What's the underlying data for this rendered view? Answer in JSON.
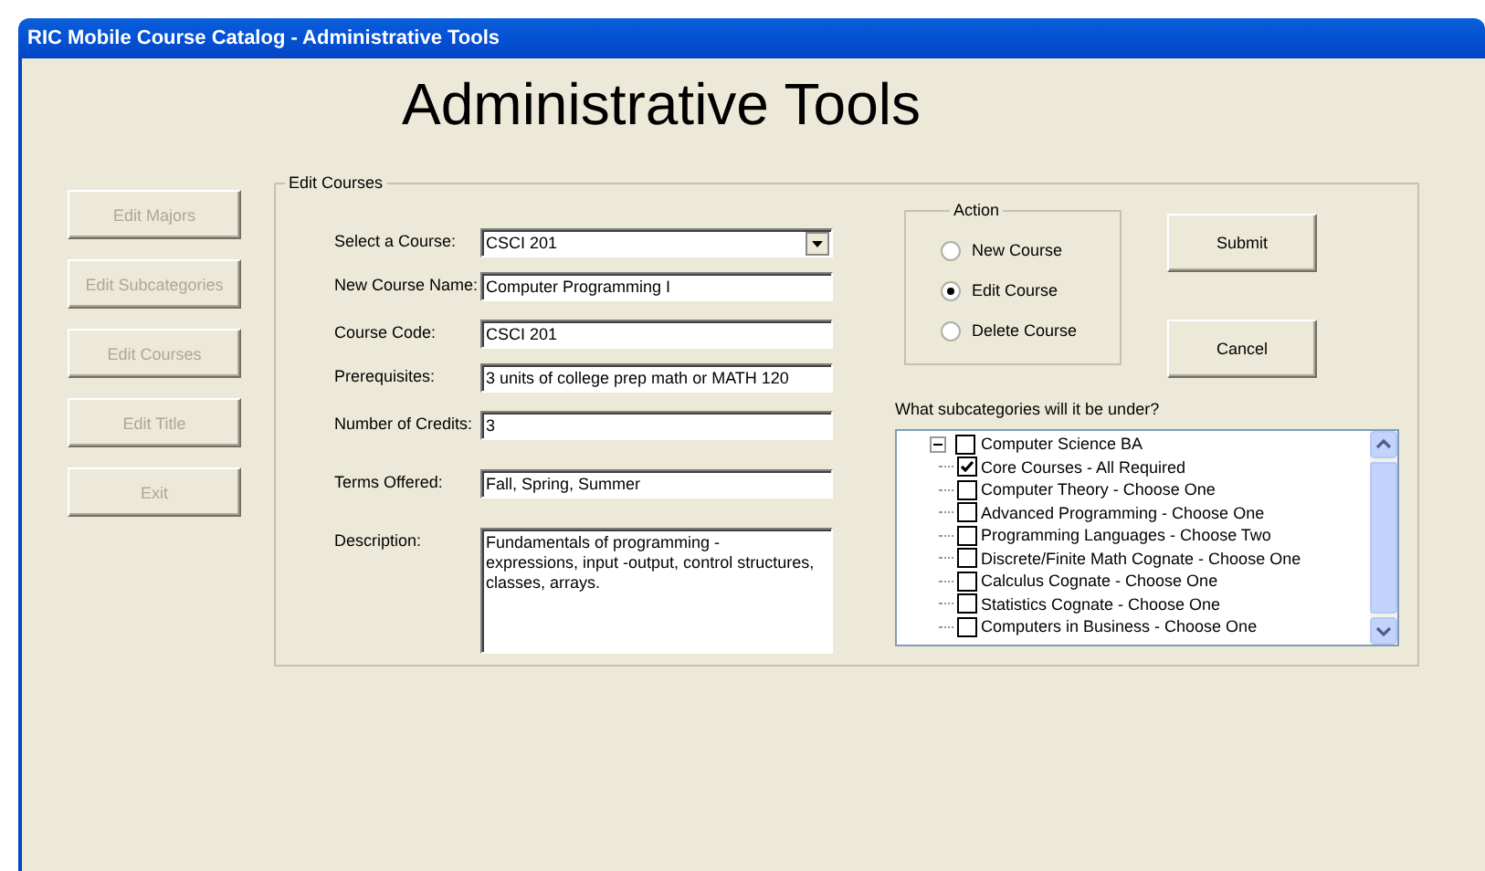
{
  "window": {
    "title": "RIC Mobile Course Catalog - Administrative Tools"
  },
  "heading": "Administrative Tools",
  "nav_buttons": [
    {
      "label": "Edit Majors",
      "disabled": true
    },
    {
      "label": "Edit Subcategories",
      "disabled": true
    },
    {
      "label": "Edit Courses",
      "disabled": true
    },
    {
      "label": "Edit Title",
      "disabled": true
    },
    {
      "label": "Exit",
      "disabled": true
    }
  ],
  "edit_courses": {
    "title": "Edit Courses",
    "fields": [
      {
        "kind": "dropdown",
        "label": "Select a Course:",
        "value": "CSCI 201"
      },
      {
        "kind": "text",
        "label": "New Course Name:",
        "value": "Computer Programming I"
      },
      {
        "kind": "text",
        "label": "Course Code:",
        "value": "CSCI 201"
      },
      {
        "kind": "text",
        "label": "Prerequisites:",
        "value": "3 units of college prep math or MATH 120"
      },
      {
        "kind": "text",
        "label": "Number of Credits:",
        "value": "3"
      },
      {
        "kind": "text",
        "label": "Terms Offered:",
        "value": "Fall, Spring, Summer"
      },
      {
        "kind": "multiline",
        "label": "Description:",
        "value": "Fundamentals of programming - expressions, input -output, control structures, classes, arrays."
      }
    ]
  },
  "action": {
    "title": "Action",
    "options": [
      {
        "label": "New Course",
        "selected": false
      },
      {
        "label": "Edit Course",
        "selected": true
      },
      {
        "label": "Delete Course",
        "selected": false
      }
    ]
  },
  "buttons": [
    "Submit",
    "Cancel"
  ],
  "subcategories": {
    "prompt": "What subcategories will it be under?",
    "tree": [
      {
        "label": "Computer Science BA",
        "checked": false,
        "expanded": true,
        "children": [
          {
            "label": "Core Courses - All Required",
            "checked": true
          },
          {
            "label": "Computer Theory - Choose One",
            "checked": false
          },
          {
            "label": "Advanced Programming - Choose One",
            "checked": false
          },
          {
            "label": "Programming Languages - Choose Two",
            "checked": false
          },
          {
            "label": "Discrete/Finite Math Cognate - Choose One",
            "checked": false
          },
          {
            "label": "Calculus Cognate - Choose One",
            "checked": false
          },
          {
            "label": "Statistics Cognate - Choose One",
            "checked": false
          },
          {
            "label": "Computers in Business - Choose One",
            "checked": false
          }
        ]
      }
    ]
  }
}
